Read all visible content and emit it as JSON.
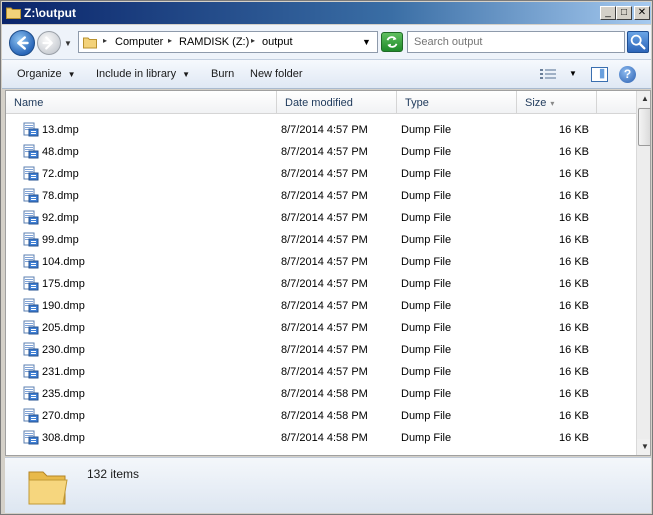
{
  "window": {
    "title": "Z:\\output"
  },
  "titlebar_buttons": {
    "minimize": "_",
    "maximize": "□",
    "close": "✕"
  },
  "address": {
    "crumbs": [
      "Computer",
      "RAMDISK (Z:)",
      "output"
    ],
    "separator": "▸",
    "dropdown": "▼"
  },
  "search": {
    "placeholder": "Search output"
  },
  "toolbar": {
    "organize": "Organize",
    "include_in_library": "Include in library",
    "burn": "Burn",
    "new_folder": "New folder",
    "caret": "▼"
  },
  "columns": {
    "name": "Name",
    "date": "Date modified",
    "type": "Type",
    "size": "Size",
    "sort_caret": "▾"
  },
  "files": [
    {
      "name": "13.dmp",
      "date": "8/7/2014 4:57 PM",
      "type": "Dump File",
      "size": "16 KB"
    },
    {
      "name": "48.dmp",
      "date": "8/7/2014 4:57 PM",
      "type": "Dump File",
      "size": "16 KB"
    },
    {
      "name": "72.dmp",
      "date": "8/7/2014 4:57 PM",
      "type": "Dump File",
      "size": "16 KB"
    },
    {
      "name": "78.dmp",
      "date": "8/7/2014 4:57 PM",
      "type": "Dump File",
      "size": "16 KB"
    },
    {
      "name": "92.dmp",
      "date": "8/7/2014 4:57 PM",
      "type": "Dump File",
      "size": "16 KB"
    },
    {
      "name": "99.dmp",
      "date": "8/7/2014 4:57 PM",
      "type": "Dump File",
      "size": "16 KB"
    },
    {
      "name": "104.dmp",
      "date": "8/7/2014 4:57 PM",
      "type": "Dump File",
      "size": "16 KB"
    },
    {
      "name": "175.dmp",
      "date": "8/7/2014 4:57 PM",
      "type": "Dump File",
      "size": "16 KB"
    },
    {
      "name": "190.dmp",
      "date": "8/7/2014 4:57 PM",
      "type": "Dump File",
      "size": "16 KB"
    },
    {
      "name": "205.dmp",
      "date": "8/7/2014 4:57 PM",
      "type": "Dump File",
      "size": "16 KB"
    },
    {
      "name": "230.dmp",
      "date": "8/7/2014 4:57 PM",
      "type": "Dump File",
      "size": "16 KB"
    },
    {
      "name": "231.dmp",
      "date": "8/7/2014 4:57 PM",
      "type": "Dump File",
      "size": "16 KB"
    },
    {
      "name": "235.dmp",
      "date": "8/7/2014 4:58 PM",
      "type": "Dump File",
      "size": "16 KB"
    },
    {
      "name": "270.dmp",
      "date": "8/7/2014 4:58 PM",
      "type": "Dump File",
      "size": "16 KB"
    },
    {
      "name": "308.dmp",
      "date": "8/7/2014 4:58 PM",
      "type": "Dump File",
      "size": "16 KB"
    }
  ],
  "status": {
    "item_count": "132 items"
  },
  "icons": {
    "back": "back-arrow-icon",
    "forward": "forward-arrow-icon",
    "folder": "folder-icon",
    "file": "dump-file-icon",
    "search": "search-icon",
    "refresh": "refresh-icon",
    "views": "view-options-icon",
    "preview_pane": "preview-pane-icon",
    "help": "help-icon"
  },
  "colors": {
    "title_bar": "#0a246a",
    "header_text": "#1e395b",
    "nav_back": "#2a67b9"
  }
}
